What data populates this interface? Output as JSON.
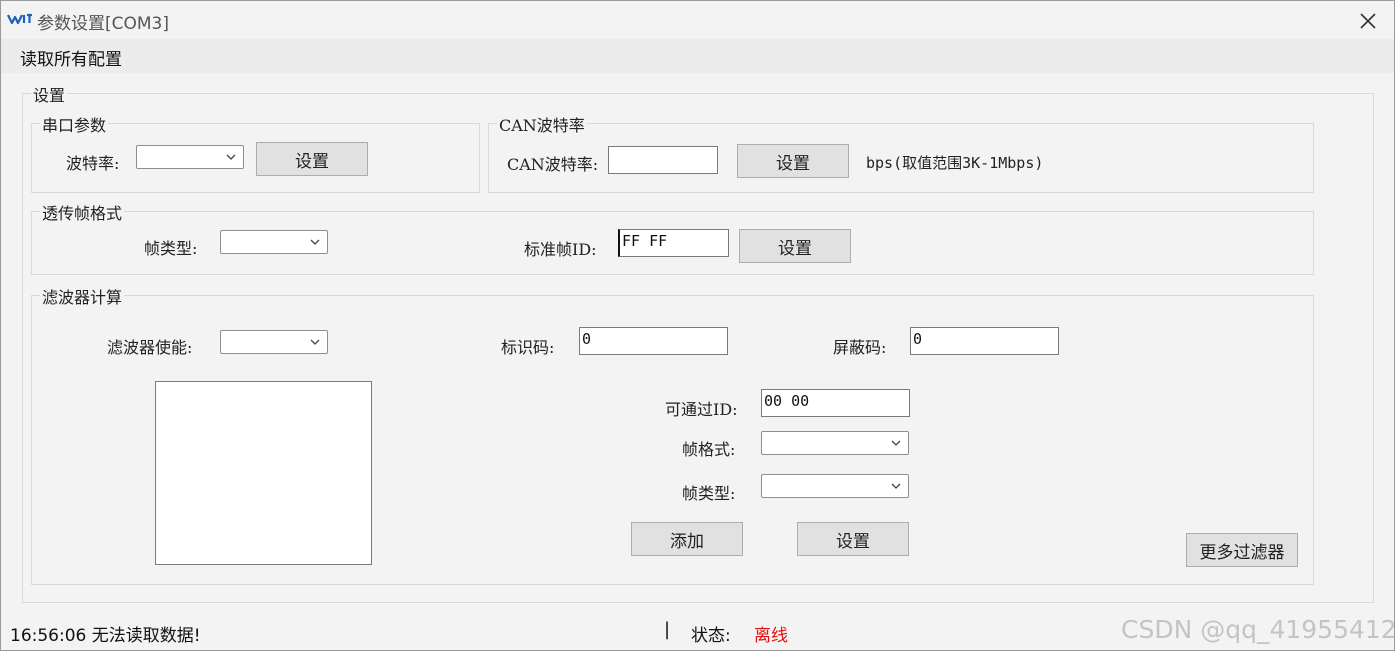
{
  "window": {
    "title": "参数设置[COM3]",
    "app_icon": "wit-logo-icon",
    "close_icon": "close-icon"
  },
  "menu": {
    "read_all": "读取所有配置"
  },
  "settings": {
    "legend": "设置",
    "serial": {
      "legend": "串口参数",
      "baud_label": "波特率:",
      "baud_value": "",
      "set_button": "设置"
    },
    "can": {
      "legend": "CAN波特率",
      "baud_label": "CAN波特率:",
      "baud_value": "",
      "set_button": "设置",
      "hint": "bps(取值范围3K-1Mbps)"
    },
    "frame": {
      "legend": "透传帧格式",
      "type_label": "帧类型:",
      "type_value": "",
      "std_id_label": "标准帧ID:",
      "std_id_value": "FF FF",
      "set_button": "设置"
    },
    "filter": {
      "legend": "滤波器计算",
      "enable_label": "滤波器使能:",
      "enable_value": "",
      "id_code_label": "标识码:",
      "id_code_value": "0",
      "mask_label": "屏蔽码:",
      "mask_value": "0",
      "pass_id_label": "可通过ID:",
      "pass_id_value": "00 00",
      "format_label": "帧格式:",
      "format_value": "",
      "type_label": "帧类型:",
      "type_value": "",
      "add_button": "添加",
      "set_button": "设置",
      "more_button": "更多过滤器"
    }
  },
  "status": {
    "message": "16:56:06 无法读取数据!",
    "separator": "|",
    "state_label": "状态:",
    "state_value": "离线",
    "state_color": "#e01010"
  },
  "watermark": "CSDN @qq_41955412"
}
